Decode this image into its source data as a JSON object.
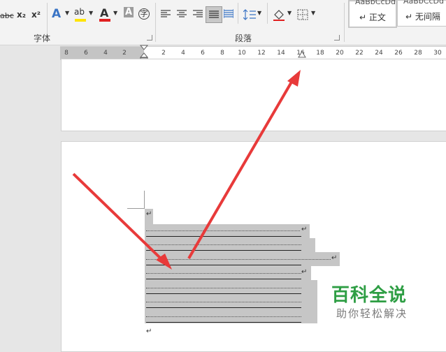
{
  "ribbon": {
    "font_group": {
      "label": "字体",
      "buttons": [
        {
          "name": "strikethrough-button",
          "text": "abc"
        },
        {
          "name": "subscript-button",
          "text": "x₂"
        },
        {
          "name": "superscript-button",
          "text": "x²"
        },
        {
          "name": "text-effects-button",
          "text": "A"
        },
        {
          "name": "highlight-button",
          "text": "ab"
        },
        {
          "name": "font-color-button",
          "text": "A"
        },
        {
          "name": "char-shading-button",
          "text": "A"
        },
        {
          "name": "enclose-char-button",
          "text": "字"
        }
      ]
    },
    "paragraph_group": {
      "label": "段落",
      "buttons": [
        {
          "name": "align-left-button"
        },
        {
          "name": "align-center-button"
        },
        {
          "name": "align-right-button"
        },
        {
          "name": "justify-button"
        },
        {
          "name": "distributed-button"
        },
        {
          "name": "line-spacing-button"
        },
        {
          "name": "shading-button"
        },
        {
          "name": "borders-button"
        }
      ]
    },
    "styles": [
      {
        "preview": "AaBbCcDd",
        "name": "正文"
      },
      {
        "preview": "AaBbCcDd",
        "name": "无间隔"
      }
    ],
    "colors": {
      "highlight": "#ffe400",
      "font_color": "#e02020",
      "shading": "#9c9c9c"
    }
  },
  "ruler": {
    "left_numbers": [
      "8",
      "6",
      "4",
      "2"
    ],
    "right_numbers": [
      "2",
      "4",
      "6",
      "8",
      "10",
      "12",
      "14",
      "16",
      "18",
      "20",
      "22",
      "24",
      "26",
      "28",
      "30"
    ]
  },
  "document": {
    "paragraph_mark": "↵"
  },
  "annotations": {
    "arrow_color": "#e83a3a"
  },
  "watermark": {
    "title": "百科全说",
    "subtitle": "助你轻松解决"
  }
}
